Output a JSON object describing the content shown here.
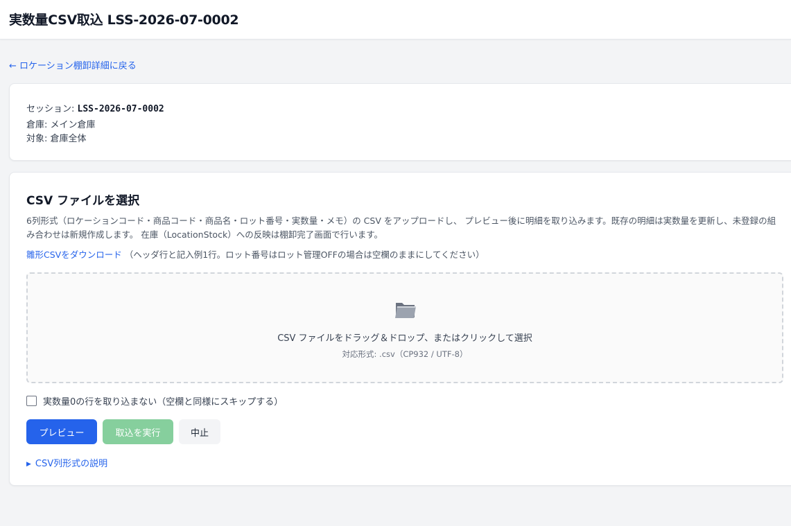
{
  "header": {
    "title": "実数量CSV取込 LSS-2026-07-0002"
  },
  "nav": {
    "back_arrow": "←",
    "back_label": "ロケーション棚卸詳細に戻る"
  },
  "session_info": {
    "session_label": "セッション: ",
    "session_value": "LSS-2026-07-0002",
    "warehouse_text": "倉庫: メイン倉庫",
    "target_text": "対象: 倉庫全体"
  },
  "upload": {
    "title": "CSV ファイルを選択",
    "description": "6列形式（ロケーションコード・商品コード・商品名・ロット番号・実数量・メモ）の CSV をアップロードし、 プレビュー後に明細を取り込みます。既存の明細は実数量を更新し、未登録の組み合わせは新規作成します。 在庫（LocationStock）への反映は棚卸完了画面で行います。",
    "template_link": "雛形CSVをダウンロード",
    "template_note": " （ヘッダ行と記入例1行。ロット番号はロット管理OFFの場合は空欄のままにしてください）",
    "dropzone_icon": "folder-icon",
    "dropzone_text": "CSV ファイルをドラッグ＆ドロップ、またはクリックして選択",
    "dropzone_subtext": "対応形式: .csv（CP932 / UTF-8）",
    "skip_zero_label": "実数量0の行を取り込まない（空欄と同様にスキップする）",
    "skip_zero_checked": false
  },
  "actions": {
    "preview_label": "プレビュー",
    "execute_label": "取込を実行",
    "cancel_label": "中止"
  },
  "help": {
    "arrow": "▶",
    "format_help_label": "CSV列形式の説明"
  },
  "colors": {
    "primary": "#2563eb",
    "execute_disabled": "#86cf9d",
    "background": "#f3f4f6"
  }
}
